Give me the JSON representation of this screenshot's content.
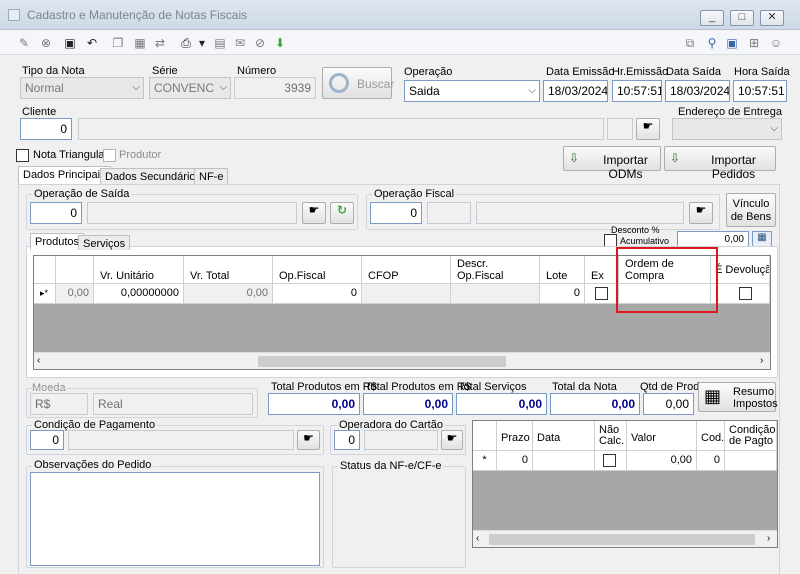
{
  "window": {
    "title": "Cadastro e Manutenção de Notas Fiscais",
    "minimize": "_",
    "maximize": "□",
    "close": "✕"
  },
  "header": {
    "tipo_nota_label": "Tipo da Nota",
    "tipo_nota_value": "Normal",
    "serie_label": "Série",
    "serie_value": "CONVENC",
    "numero_label": "Número",
    "numero_value": "3939",
    "buscar_label": "Buscar",
    "operacao_label": "Operação",
    "operacao_value": "Saida",
    "data_emissao_label": "Data Emissão",
    "data_emissao_value": "18/03/2024",
    "hr_emissao_label": "Hr.Emissão",
    "hr_emissao_value": "10:57:51",
    "data_saida_label": "Data Saída",
    "data_saida_value": "18/03/2024",
    "hora_saida_label": "Hora Saída",
    "hora_saida_value": "10:57:51"
  },
  "cliente": {
    "label": "Cliente",
    "code": "0",
    "endereco_label": "Endereço de Entrega"
  },
  "options": {
    "nota_triangular": "Nota Triangular",
    "produtor": "Produtor",
    "importar_odms": "Importar ODMs",
    "importar_pedidos": "Importar Pedidos"
  },
  "tabs": {
    "dados_principais": "Dados Principais",
    "dados_secundarios": "Dados Secundários",
    "nfe": "NF-e"
  },
  "operacao_saida": {
    "label": "Operação de Saída",
    "code": "0"
  },
  "operacao_fiscal": {
    "label": "Operação Fiscal",
    "code": "0"
  },
  "vinculo_bens": {
    "line1": "Vínculo",
    "line2": "de Bens"
  },
  "desconto": {
    "label": "Desconto %",
    "acumulativo": "Acumulativo",
    "value": "0,00"
  },
  "subtabs": {
    "produtos": "Produtos",
    "servicos": "Serviços"
  },
  "products_grid": {
    "columns": {
      "vr_unitario": "Vr. Unitário",
      "vr_total": "Vr. Total",
      "op_fiscal": "Op.Fiscal",
      "cfop": "CFOP",
      "descr_line1": "Descr.",
      "descr_line2": "Op.Fiscal",
      "lote": "Lote",
      "ex": "Ex",
      "ordem_line1": "Ordem de",
      "ordem_line2": "Compra",
      "devolucao": "É Devolução"
    },
    "row": {
      "marker": "▸*",
      "first": "0,00",
      "vr_unitario": "0,00000000",
      "vr_total": "0,00",
      "op_fiscal": "0",
      "lote": "0"
    }
  },
  "totals": {
    "moeda_label": "Moeda",
    "moeda_code": "R$",
    "moeda_name": "Real",
    "total_produtos_label": "Total Produtos em R$",
    "total_produtos_value": "0,00",
    "total_produtos2_label": "Total Produtos em R$",
    "total_produtos2_value": "0,00",
    "total_servicos_label": "Total Serviços",
    "total_servicos_value": "0,00",
    "total_nota_label": "Total da Nota",
    "total_nota_value": "0,00",
    "qtd_prod_label": "Qtd de Prod.",
    "qtd_prod_value": "0,00",
    "resumo_line1": "Resumo",
    "resumo_line2": "Impostos"
  },
  "pagamento": {
    "condicao_label": "Condição de Pagamento",
    "condicao_code": "0",
    "operadora_label": "Operadora do Cartão",
    "operadora_code": "0"
  },
  "observacoes_label": "Observações do Pedido",
  "status_label": "Status da NF-e/CF-e",
  "installments_grid": {
    "columns": {
      "prazo": "Prazo",
      "data": "Data",
      "nao_line1": "Não",
      "nao_line2": "Calc.",
      "valor": "Valor",
      "cod": "Cod.",
      "cond_line1": "Condição",
      "cond_line2": "de Pagto"
    },
    "row": {
      "marker": "*",
      "prazo": "0",
      "valor": "0,00",
      "cod": "0"
    }
  }
}
